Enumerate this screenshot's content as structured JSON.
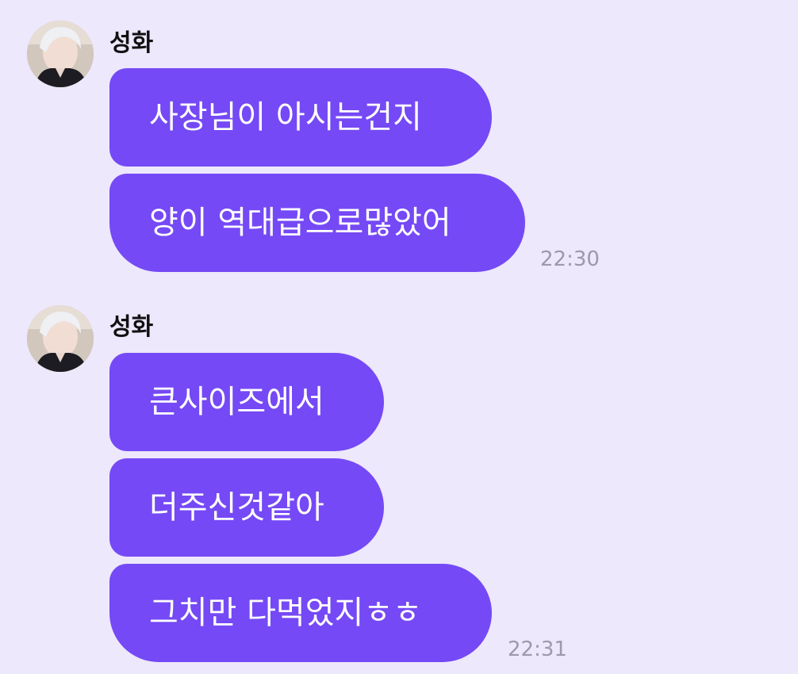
{
  "theme": {
    "background": "#ede8fb",
    "bubble_color": "#7549f5",
    "text_on_bubble": "#ffffff",
    "timestamp_color": "#9d98ab"
  },
  "groups": [
    {
      "sender": "성화",
      "avatar": "profile-photo",
      "messages": [
        {
          "text": "사장님이 아시는건지"
        },
        {
          "text": "양이 역대급으로많았어"
        }
      ],
      "time": "22:30"
    },
    {
      "sender": "성화",
      "avatar": "profile-photo",
      "messages": [
        {
          "text": "큰사이즈에서"
        },
        {
          "text": "더주신것같아"
        },
        {
          "text": "그치만 다먹었지ㅎㅎ"
        }
      ],
      "time": "22:31"
    }
  ]
}
